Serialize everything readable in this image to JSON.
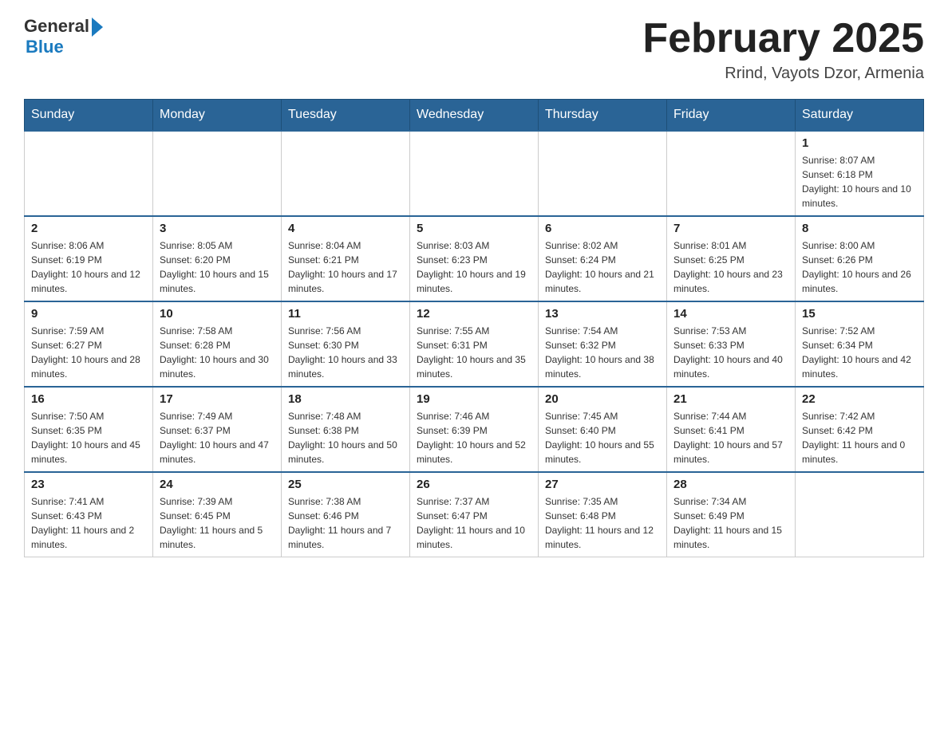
{
  "header": {
    "logo_general": "General",
    "logo_blue": "Blue",
    "month_title": "February 2025",
    "location": "Rrind, Vayots Dzor, Armenia"
  },
  "days_of_week": [
    "Sunday",
    "Monday",
    "Tuesday",
    "Wednesday",
    "Thursday",
    "Friday",
    "Saturday"
  ],
  "weeks": [
    [
      {
        "num": "",
        "sunrise": "",
        "sunset": "",
        "daylight": ""
      },
      {
        "num": "",
        "sunrise": "",
        "sunset": "",
        "daylight": ""
      },
      {
        "num": "",
        "sunrise": "",
        "sunset": "",
        "daylight": ""
      },
      {
        "num": "",
        "sunrise": "",
        "sunset": "",
        "daylight": ""
      },
      {
        "num": "",
        "sunrise": "",
        "sunset": "",
        "daylight": ""
      },
      {
        "num": "",
        "sunrise": "",
        "sunset": "",
        "daylight": ""
      },
      {
        "num": "1",
        "sunrise": "Sunrise: 8:07 AM",
        "sunset": "Sunset: 6:18 PM",
        "daylight": "Daylight: 10 hours and 10 minutes."
      }
    ],
    [
      {
        "num": "2",
        "sunrise": "Sunrise: 8:06 AM",
        "sunset": "Sunset: 6:19 PM",
        "daylight": "Daylight: 10 hours and 12 minutes."
      },
      {
        "num": "3",
        "sunrise": "Sunrise: 8:05 AM",
        "sunset": "Sunset: 6:20 PM",
        "daylight": "Daylight: 10 hours and 15 minutes."
      },
      {
        "num": "4",
        "sunrise": "Sunrise: 8:04 AM",
        "sunset": "Sunset: 6:21 PM",
        "daylight": "Daylight: 10 hours and 17 minutes."
      },
      {
        "num": "5",
        "sunrise": "Sunrise: 8:03 AM",
        "sunset": "Sunset: 6:23 PM",
        "daylight": "Daylight: 10 hours and 19 minutes."
      },
      {
        "num": "6",
        "sunrise": "Sunrise: 8:02 AM",
        "sunset": "Sunset: 6:24 PM",
        "daylight": "Daylight: 10 hours and 21 minutes."
      },
      {
        "num": "7",
        "sunrise": "Sunrise: 8:01 AM",
        "sunset": "Sunset: 6:25 PM",
        "daylight": "Daylight: 10 hours and 23 minutes."
      },
      {
        "num": "8",
        "sunrise": "Sunrise: 8:00 AM",
        "sunset": "Sunset: 6:26 PM",
        "daylight": "Daylight: 10 hours and 26 minutes."
      }
    ],
    [
      {
        "num": "9",
        "sunrise": "Sunrise: 7:59 AM",
        "sunset": "Sunset: 6:27 PM",
        "daylight": "Daylight: 10 hours and 28 minutes."
      },
      {
        "num": "10",
        "sunrise": "Sunrise: 7:58 AM",
        "sunset": "Sunset: 6:28 PM",
        "daylight": "Daylight: 10 hours and 30 minutes."
      },
      {
        "num": "11",
        "sunrise": "Sunrise: 7:56 AM",
        "sunset": "Sunset: 6:30 PM",
        "daylight": "Daylight: 10 hours and 33 minutes."
      },
      {
        "num": "12",
        "sunrise": "Sunrise: 7:55 AM",
        "sunset": "Sunset: 6:31 PM",
        "daylight": "Daylight: 10 hours and 35 minutes."
      },
      {
        "num": "13",
        "sunrise": "Sunrise: 7:54 AM",
        "sunset": "Sunset: 6:32 PM",
        "daylight": "Daylight: 10 hours and 38 minutes."
      },
      {
        "num": "14",
        "sunrise": "Sunrise: 7:53 AM",
        "sunset": "Sunset: 6:33 PM",
        "daylight": "Daylight: 10 hours and 40 minutes."
      },
      {
        "num": "15",
        "sunrise": "Sunrise: 7:52 AM",
        "sunset": "Sunset: 6:34 PM",
        "daylight": "Daylight: 10 hours and 42 minutes."
      }
    ],
    [
      {
        "num": "16",
        "sunrise": "Sunrise: 7:50 AM",
        "sunset": "Sunset: 6:35 PM",
        "daylight": "Daylight: 10 hours and 45 minutes."
      },
      {
        "num": "17",
        "sunrise": "Sunrise: 7:49 AM",
        "sunset": "Sunset: 6:37 PM",
        "daylight": "Daylight: 10 hours and 47 minutes."
      },
      {
        "num": "18",
        "sunrise": "Sunrise: 7:48 AM",
        "sunset": "Sunset: 6:38 PM",
        "daylight": "Daylight: 10 hours and 50 minutes."
      },
      {
        "num": "19",
        "sunrise": "Sunrise: 7:46 AM",
        "sunset": "Sunset: 6:39 PM",
        "daylight": "Daylight: 10 hours and 52 minutes."
      },
      {
        "num": "20",
        "sunrise": "Sunrise: 7:45 AM",
        "sunset": "Sunset: 6:40 PM",
        "daylight": "Daylight: 10 hours and 55 minutes."
      },
      {
        "num": "21",
        "sunrise": "Sunrise: 7:44 AM",
        "sunset": "Sunset: 6:41 PM",
        "daylight": "Daylight: 10 hours and 57 minutes."
      },
      {
        "num": "22",
        "sunrise": "Sunrise: 7:42 AM",
        "sunset": "Sunset: 6:42 PM",
        "daylight": "Daylight: 11 hours and 0 minutes."
      }
    ],
    [
      {
        "num": "23",
        "sunrise": "Sunrise: 7:41 AM",
        "sunset": "Sunset: 6:43 PM",
        "daylight": "Daylight: 11 hours and 2 minutes."
      },
      {
        "num": "24",
        "sunrise": "Sunrise: 7:39 AM",
        "sunset": "Sunset: 6:45 PM",
        "daylight": "Daylight: 11 hours and 5 minutes."
      },
      {
        "num": "25",
        "sunrise": "Sunrise: 7:38 AM",
        "sunset": "Sunset: 6:46 PM",
        "daylight": "Daylight: 11 hours and 7 minutes."
      },
      {
        "num": "26",
        "sunrise": "Sunrise: 7:37 AM",
        "sunset": "Sunset: 6:47 PM",
        "daylight": "Daylight: 11 hours and 10 minutes."
      },
      {
        "num": "27",
        "sunrise": "Sunrise: 7:35 AM",
        "sunset": "Sunset: 6:48 PM",
        "daylight": "Daylight: 11 hours and 12 minutes."
      },
      {
        "num": "28",
        "sunrise": "Sunrise: 7:34 AM",
        "sunset": "Sunset: 6:49 PM",
        "daylight": "Daylight: 11 hours and 15 minutes."
      },
      {
        "num": "",
        "sunrise": "",
        "sunset": "",
        "daylight": ""
      }
    ]
  ]
}
